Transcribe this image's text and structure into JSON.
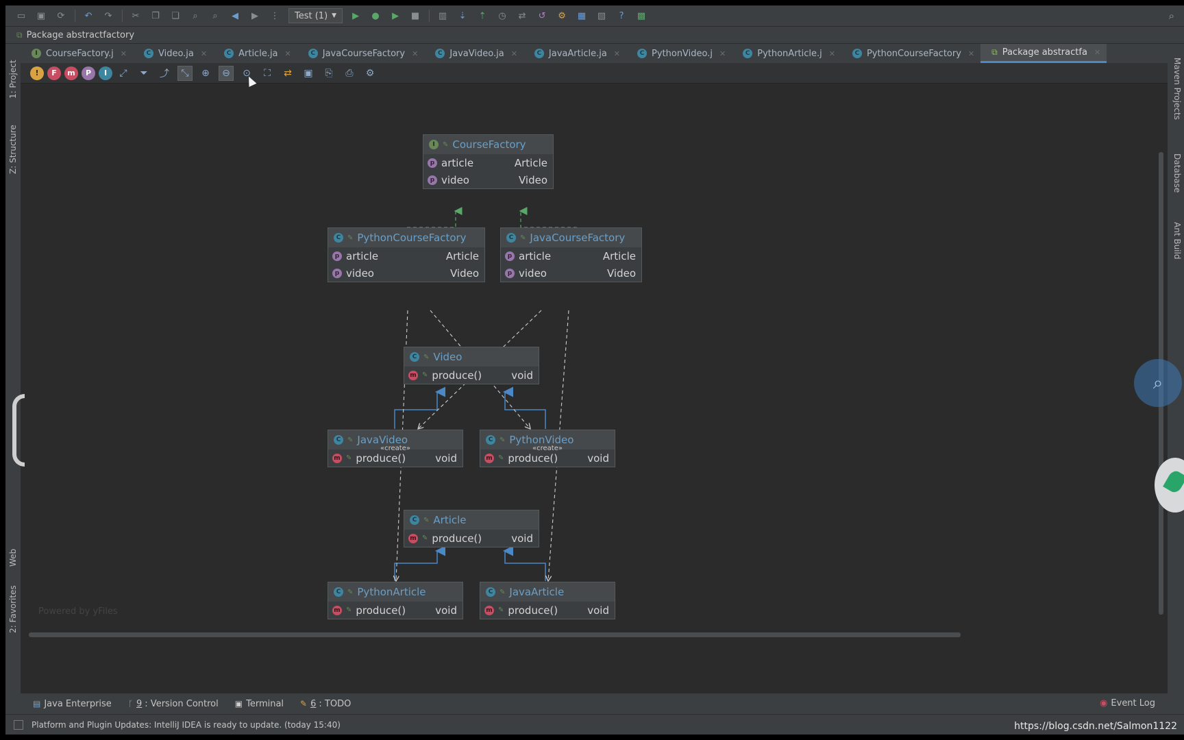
{
  "toolbar": {
    "run_config": "Test (1)",
    "icons": [
      "open-icon",
      "save-icon",
      "sync-icon",
      "undo-icon",
      "redo-icon",
      "cut-icon",
      "copy-icon",
      "paste-icon",
      "find-icon",
      "replace-icon",
      "back-icon",
      "forward-icon",
      "structure-icon",
      "run-icon",
      "debug-icon",
      "coverage-icon",
      "stop-icon",
      "build-icon",
      "vcs-update-icon",
      "vcs-commit-icon",
      "vcs-history-icon",
      "vcs-compare-icon",
      "revert-icon",
      "settings-icon",
      "project-structure-icon",
      "sdk-icon",
      "help-icon",
      "plugin-icon",
      "search-icon"
    ]
  },
  "breadcrumb": {
    "text": "Package abstractfactory"
  },
  "left_stripe": {
    "project": "1: Project",
    "structure": "Z: Structure",
    "web": "Web",
    "favorites": "2: Favorites"
  },
  "right_stripe": {
    "maven": "Maven Projects",
    "database": "Database",
    "ant": "Ant Build"
  },
  "tabs": [
    {
      "label": "CourseFactory.j",
      "kind": "interface"
    },
    {
      "label": "Video.ja",
      "kind": "class"
    },
    {
      "label": "Article.ja",
      "kind": "class"
    },
    {
      "label": "JavaCourseFactory",
      "kind": "class"
    },
    {
      "label": "JavaVideo.ja",
      "kind": "class"
    },
    {
      "label": "JavaArticle.ja",
      "kind": "class"
    },
    {
      "label": "PythonVideo.j",
      "kind": "class"
    },
    {
      "label": "PythonArticle.j",
      "kind": "class"
    },
    {
      "label": "PythonCourseFactory",
      "kind": "class"
    },
    {
      "label": "Package abstractfa",
      "kind": "diagram",
      "active": true
    }
  ],
  "diagram_toolbar": {
    "filters": [
      "!",
      "F",
      "m",
      "P",
      "I"
    ],
    "tools": [
      "layout-icon",
      "filter-icon",
      "export-icon",
      "show-edges-icon",
      "zoom-in-icon",
      "zoom-out-icon",
      "actual-size-icon",
      "fit-content-icon",
      "apply-layout-icon",
      "save-icon",
      "export-file-icon",
      "print-icon",
      "settings-icon"
    ]
  },
  "diagram": {
    "CourseFactory": {
      "title": "CourseFactory",
      "kind": "I",
      "rows": [
        {
          "name": "article",
          "type": "Article",
          "kind": "p"
        },
        {
          "name": "video",
          "type": "Video",
          "kind": "p"
        }
      ]
    },
    "PythonCourseFactory": {
      "title": "PythonCourseFactory",
      "kind": "C",
      "rows": [
        {
          "name": "article",
          "type": "Article",
          "kind": "p"
        },
        {
          "name": "video",
          "type": "Video",
          "kind": "p"
        }
      ]
    },
    "JavaCourseFactory": {
      "title": "JavaCourseFactory",
      "kind": "C",
      "rows": [
        {
          "name": "article",
          "type": "Article",
          "kind": "p"
        },
        {
          "name": "video",
          "type": "Video",
          "kind": "p"
        }
      ]
    },
    "Video": {
      "title": "Video",
      "kind": "C",
      "rows": [
        {
          "name": "produce()",
          "type": "void",
          "kind": "m"
        }
      ]
    },
    "JavaVideo": {
      "title": "JavaVideo",
      "kind": "C",
      "stereotype": "«create»",
      "rows": [
        {
          "name": "produce()",
          "type": "void",
          "kind": "m"
        }
      ]
    },
    "PythonVideo": {
      "title": "PythonVideo",
      "kind": "C",
      "stereotype": "«create»",
      "rows": [
        {
          "name": "produce()",
          "type": "void",
          "kind": "m"
        }
      ]
    },
    "Article": {
      "title": "Article",
      "kind": "C",
      "rows": [
        {
          "name": "produce()",
          "type": "void",
          "kind": "m"
        }
      ]
    },
    "PythonArticle": {
      "title": "PythonArticle",
      "kind": "C",
      "rows": [
        {
          "name": "produce()",
          "type": "void",
          "kind": "m"
        }
      ]
    },
    "JavaArticle": {
      "title": "JavaArticle",
      "kind": "C",
      "rows": [
        {
          "name": "produce()",
          "type": "void",
          "kind": "m"
        }
      ]
    },
    "edges": [
      {
        "from": "PythonCourseFactory",
        "to": "CourseFactory",
        "type": "implements"
      },
      {
        "from": "JavaCourseFactory",
        "to": "CourseFactory",
        "type": "implements"
      },
      {
        "from": "JavaVideo",
        "to": "Video",
        "type": "extends"
      },
      {
        "from": "PythonVideo",
        "to": "Video",
        "type": "extends"
      },
      {
        "from": "PythonArticle",
        "to": "Article",
        "type": "extends"
      },
      {
        "from": "JavaArticle",
        "to": "Article",
        "type": "extends"
      },
      {
        "from": "PythonCourseFactory",
        "to": "PythonVideo",
        "type": "create"
      },
      {
        "from": "JavaCourseFactory",
        "to": "JavaVideo",
        "type": "create"
      },
      {
        "from": "PythonCourseFactory",
        "to": "PythonArticle",
        "type": "create"
      },
      {
        "from": "JavaCourseFactory",
        "to": "JavaArticle",
        "type": "create"
      }
    ],
    "watermark": "Powered by yFiles"
  },
  "bottom_tools": [
    {
      "num": "",
      "label": "Java Enterprise",
      "icon": "java-enterprise-icon"
    },
    {
      "num": "9",
      "label": ": Version Control",
      "icon": "vcs-icon"
    },
    {
      "num": "",
      "label": "Terminal",
      "icon": "terminal-icon"
    },
    {
      "num": "6",
      "label": ": TODO",
      "icon": "todo-icon"
    }
  ],
  "event_log": "Event Log",
  "status": "Platform and Plugin Updates: IntelliJ IDEA is ready to update. (today 15:40)",
  "credit": "https://blog.csdn.net/Salmon1122",
  "colors": {
    "accent": "#4a88c7",
    "class_icon": "#3e86a0",
    "interface_icon": "#6a8759",
    "property_icon": "#9876aa",
    "method_icon": "#c74d62",
    "implements_edge": "#59a869",
    "extends_edge": "#4a88c7"
  }
}
